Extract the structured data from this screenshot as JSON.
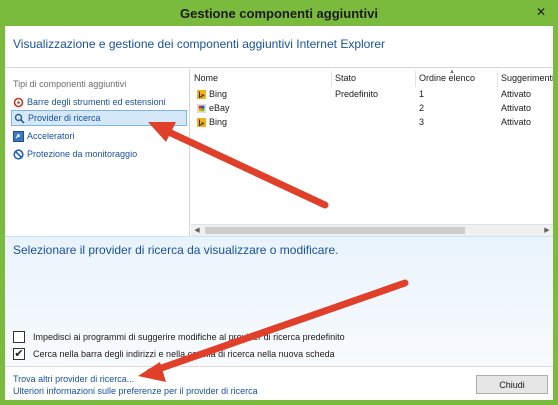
{
  "window": {
    "title": "Gestione componenti aggiuntivi",
    "close_glyph": "✕"
  },
  "header": {
    "text": "Visualizzazione e gestione dei componenti aggiuntivi Internet Explorer"
  },
  "left": {
    "group_title": "Tipi di componenti aggiuntivi",
    "items": [
      {
        "label": "Barre degli strumenti ed estensioni",
        "icon": "gear-icon"
      },
      {
        "label": "Provider di ricerca",
        "icon": "search-icon"
      },
      {
        "label": "Acceleratori",
        "icon": "accelerator-icon"
      },
      {
        "label": "Protezione da monitoraggio",
        "icon": "block-icon"
      }
    ]
  },
  "table": {
    "columns": [
      "Nome",
      "Stato",
      "Ordine elenco",
      "Suggerimenti p"
    ],
    "rows": [
      {
        "name": "Bing",
        "stato": "Predefinito",
        "ordine": "1",
        "suggerimenti": "Attivato",
        "icon": "bing-icon"
      },
      {
        "name": "eBay",
        "stato": "",
        "ordine": "2",
        "suggerimenti": "Attivato",
        "icon": "ebay-icon"
      },
      {
        "name": "Bing",
        "stato": "",
        "ordine": "3",
        "suggerimenti": "Attivato",
        "icon": "bing-icon"
      }
    ]
  },
  "details": {
    "title": "Selezionare il provider di ricerca da visualizzare o modificare.",
    "checkbox1": {
      "label": "Impedisci ai programmi di suggerire modifiche al provider di ricerca predefinito",
      "checked": false
    },
    "checkbox2": {
      "label": "Cerca nella barra degli indirizzi e nella casella di ricerca nella nuova scheda",
      "checked": true,
      "check_glyph": "✔"
    }
  },
  "footer": {
    "link1": "Trova altri provider di ricerca...",
    "link2": "Ulteriori informazioni sulle preferenze per il provider di ricerca",
    "close_label": "Chiudi"
  },
  "colors": {
    "frame": "#7aba3c",
    "link": "#1a52a0",
    "arrow": "#e0402a",
    "selection": "#d5e8f8"
  }
}
